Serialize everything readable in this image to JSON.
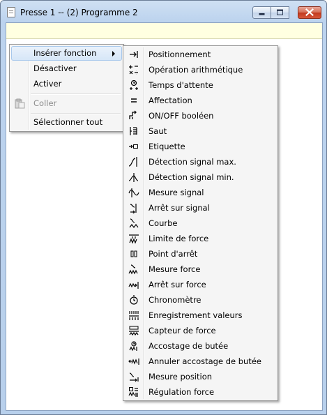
{
  "window": {
    "title": "Presse 1 -- (2) Programme 2"
  },
  "context_menu": {
    "items": [
      {
        "label": "Insérer fonction",
        "state": "highlighted",
        "has_submenu": true
      },
      {
        "label": "Désactiver",
        "state": "enabled"
      },
      {
        "label": "Activer",
        "state": "enabled"
      },
      {
        "label": "Coller",
        "state": "disabled",
        "icon": "paste-icon"
      },
      {
        "label": "Sélectionner tout",
        "state": "enabled"
      }
    ]
  },
  "submenu": {
    "items": [
      {
        "label": "Positionnement",
        "icon": "positioning-icon"
      },
      {
        "label": "Opération arithmétique",
        "icon": "arithmetic-icon"
      },
      {
        "label": "Temps d'attente",
        "icon": "wait-time-icon"
      },
      {
        "label": "Affectation",
        "icon": "assignment-icon"
      },
      {
        "label": "ON/OFF booléen",
        "icon": "boolean-toggle-icon"
      },
      {
        "label": "Saut",
        "icon": "jump-icon"
      },
      {
        "label": "Etiquette",
        "icon": "label-tag-icon"
      },
      {
        "label": "Détection signal max.",
        "icon": "signal-max-icon"
      },
      {
        "label": "Détection signal min.",
        "icon": "signal-min-icon"
      },
      {
        "label": "Mesure signal",
        "icon": "signal-measure-icon"
      },
      {
        "label": "Arrêt sur signal",
        "icon": "signal-stop-icon"
      },
      {
        "label": "Courbe",
        "icon": "curve-icon"
      },
      {
        "label": "Limite de force",
        "icon": "force-limit-icon"
      },
      {
        "label": "Point d'arrêt",
        "icon": "breakpoint-icon"
      },
      {
        "label": "Mesure force",
        "icon": "force-measure-icon"
      },
      {
        "label": "Arrêt sur force",
        "icon": "force-stop-icon"
      },
      {
        "label": "Chronomètre",
        "icon": "stopwatch-icon"
      },
      {
        "label": "Enregistrement valeurs",
        "icon": "value-recording-icon"
      },
      {
        "label": "Capteur de force",
        "icon": "force-sensor-icon"
      },
      {
        "label": "Accostage de butée",
        "icon": "stop-approach-icon"
      },
      {
        "label": "Annuler accostage de butée",
        "icon": "cancel-stop-approach-icon"
      },
      {
        "label": "Mesure position",
        "icon": "position-measure-icon"
      },
      {
        "label": "Régulation force",
        "icon": "force-regulation-icon"
      }
    ]
  }
}
